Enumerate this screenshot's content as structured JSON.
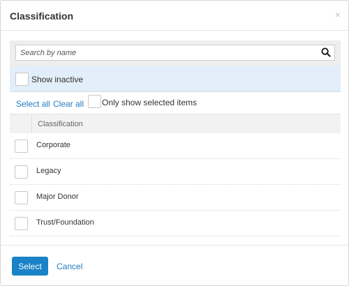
{
  "dialog": {
    "title": "Classification",
    "close_icon": "close-icon",
    "close_glyph": "×"
  },
  "search": {
    "placeholder": "Search by name",
    "value": "",
    "icon": "search-icon"
  },
  "filters": {
    "show_inactive_label": "Show inactive",
    "show_inactive_checked": false,
    "select_all_label": "Select all",
    "clear_all_label": "Clear all",
    "only_selected_label": "Only show selected items",
    "only_selected_checked": false
  },
  "table": {
    "column_header": "Classification",
    "rows": [
      {
        "label": "Corporate",
        "checked": false
      },
      {
        "label": "Legacy",
        "checked": false
      },
      {
        "label": "Major Donor",
        "checked": false
      },
      {
        "label": "Trust/Foundation",
        "checked": false
      }
    ]
  },
  "footer": {
    "select_label": "Select",
    "cancel_label": "Cancel"
  },
  "colors": {
    "accent": "#1a82c6",
    "link": "#1f7ac2",
    "highlight_row": "#e2eef9"
  }
}
